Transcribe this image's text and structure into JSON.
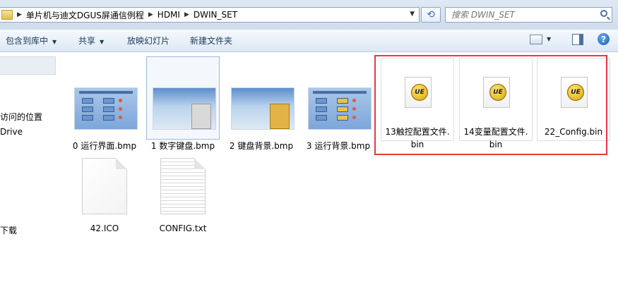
{
  "address": {
    "crumbs": [
      "单片机与迪文DGUS屏通信例程",
      "HDMI",
      "DWIN_SET"
    ],
    "refresh_label": "⟲",
    "search_placeholder": "搜索 DWIN_SET"
  },
  "toolbar": {
    "include_library": "包含到库中",
    "share": "共享",
    "slideshow": "放映幻灯片",
    "new_folder": "新建文件夹",
    "help_label": "?"
  },
  "nav": {
    "items": [
      "访问的位置",
      "Drive",
      "下载"
    ]
  },
  "files": [
    {
      "name": "0 运行界面.bmp"
    },
    {
      "name": "1 数字键盘.bmp"
    },
    {
      "name": "2 键盘背景.bmp"
    },
    {
      "name": "3 运行背景.bmp"
    },
    {
      "name_line1": "13触控配置文件.",
      "name_line2": "bin"
    },
    {
      "name_line1": "14变量配置文件.",
      "name_line2": "bin"
    },
    {
      "name": "22_Config.bin"
    },
    {
      "name": "42.ICO"
    },
    {
      "name": "CONFIG.txt"
    }
  ],
  "ue_logo_text": "UE",
  "colors": {
    "highlight_box": "#e53a3a",
    "toolbar_text": "#1e395b"
  }
}
